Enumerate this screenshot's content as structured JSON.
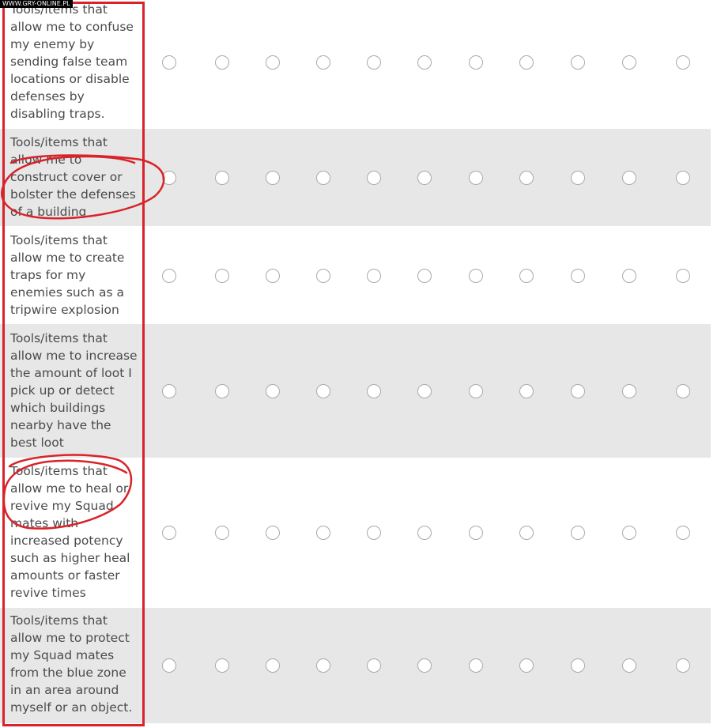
{
  "watermark": "WWW.GRY-ONLINE.PL",
  "annotation_color": "#d9232a",
  "scale_points": 11,
  "rows": [
    {
      "label": "Tools/items that allow me to confuse my enemy by sending false team locations or disable defenses by disabling traps."
    },
    {
      "label": "Tools/items that allow me to construct cover or bolster the defenses of a building"
    },
    {
      "label": "Tools/items that allow me to create traps for my enemies such as a tripwire explosion"
    },
    {
      "label": "Tools/items that allow me to increase the amount of loot I pick up or detect which buildings nearby have the best loot"
    },
    {
      "label": "Tools/items that allow me to heal or revive my Squad mates with increased potency such as higher heal amounts or faster revive times"
    },
    {
      "label": "Tools/items that allow me to protect my Squad mates from the blue zone in an area around myself or an object."
    }
  ]
}
